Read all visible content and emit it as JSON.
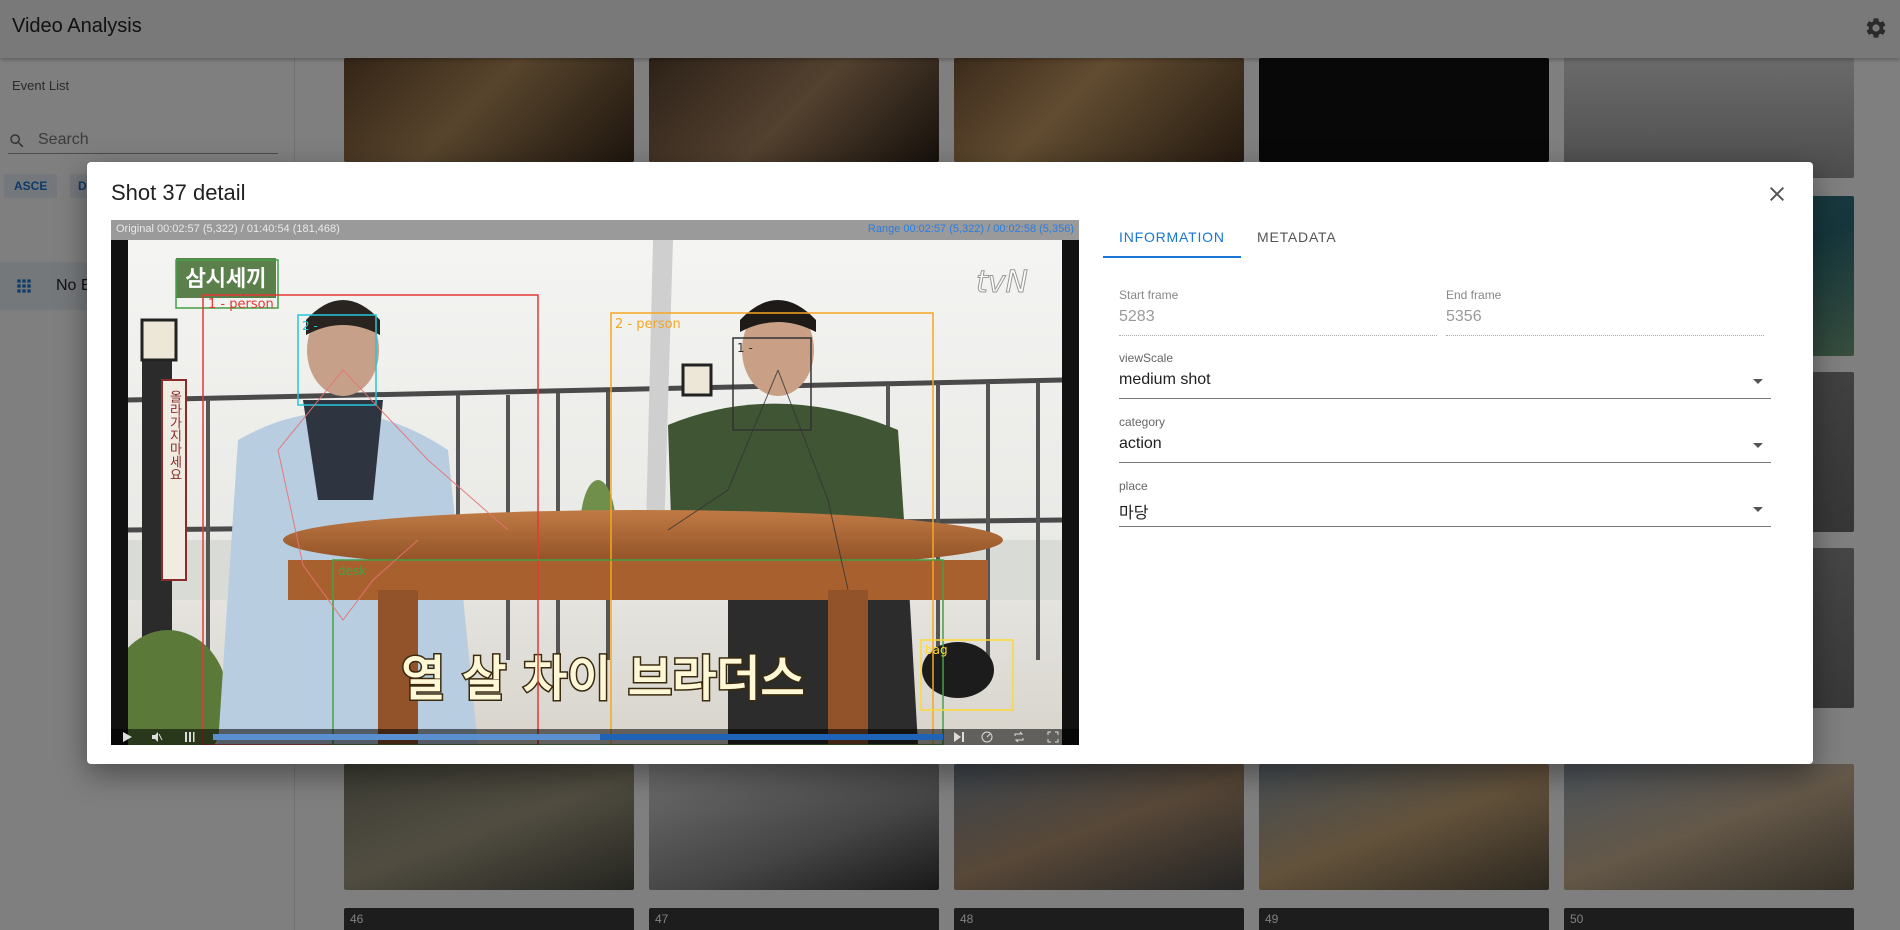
{
  "app": {
    "title": "Video Analysis",
    "settings_icon": "gear-icon"
  },
  "sidebar": {
    "section_label": "Event List",
    "search_placeholder": "Search",
    "sort_asc": "ASCE",
    "sort_desc_partial": "D",
    "list_item": "No E"
  },
  "grid": {
    "visible_numbers": [
      "46",
      "47",
      "48",
      "49",
      "50"
    ]
  },
  "dialog": {
    "title": "Shot 37 detail",
    "close_icon": "close-icon",
    "player": {
      "original_info": "Original 00:02:57 (5,322) / 01:40:54 (181,468)",
      "range_info": "Range 00:02:57 (5,322) / 00:02:58 (5,356)",
      "progress_played": 0.53,
      "progress_buffered": 1.0,
      "watermark": "tvN",
      "subtitle": "열 살 차이 브라더스",
      "show_logo": "삼시세끼",
      "sign_text": "올라가지마세요",
      "detections": [
        {
          "label": "1 - person",
          "color": "#e53935"
        },
        {
          "label": "2 - person",
          "color": "#f5a623"
        },
        {
          "label": "2 -",
          "color": "#26c6da"
        },
        {
          "label": "1 -",
          "color": "#333333"
        },
        {
          "label": "desk",
          "color": "#43a047"
        },
        {
          "label": "bag",
          "color": "#fdd835"
        }
      ]
    },
    "tabs": [
      "INFORMATION",
      "METADATA"
    ],
    "active_tab": "INFORMATION",
    "fields": {
      "start_frame": {
        "label": "Start frame",
        "value": "5283"
      },
      "end_frame": {
        "label": "End frame",
        "value": "5356"
      },
      "view_scale": {
        "label": "viewScale",
        "value": "medium shot"
      },
      "category": {
        "label": "category",
        "value": "action"
      },
      "place": {
        "label": "place",
        "value": "마당"
      }
    }
  }
}
